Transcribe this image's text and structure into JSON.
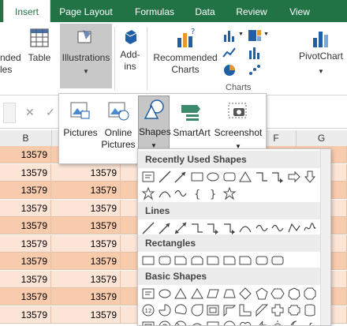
{
  "tabs": [
    "Insert",
    "Page Layout",
    "Formulas",
    "Data",
    "Review",
    "View"
  ],
  "ribbon": {
    "recommended_pivot_partial": "nded",
    "recommended_pivot_partial2": "les",
    "table": "Table",
    "illustrations": "Illustrations",
    "addins_line1": "Add-",
    "addins_line2": "ins",
    "recommended_charts_line1": "Recommended",
    "recommended_charts_line2": "Charts",
    "pivotchart": "PivotChart",
    "charts_group": "Charts"
  },
  "formula_bar": {
    "cancel": "✕",
    "confirm": "✓"
  },
  "columns": [
    "B",
    "C",
    "D",
    "E",
    "F",
    "G"
  ],
  "cell_value": "13579",
  "row_count": 10,
  "illustrations_menu": {
    "pictures": "Pictures",
    "online_line1": "Online",
    "online_line2": "Pictures",
    "shapes": "Shapes",
    "smartart": "SmartArt",
    "screenshot": "Screenshot"
  },
  "shapes_gallery": {
    "recent": "Recently Used Shapes",
    "lines": "Lines",
    "rectangles": "Rectangles",
    "basic": "Basic Shapes",
    "circled": [
      "12",
      "10",
      "10"
    ]
  },
  "colors": {
    "accent": "#217346",
    "cell_fill_a": "#f8cbad",
    "cell_fill_b": "#fce4d6"
  }
}
